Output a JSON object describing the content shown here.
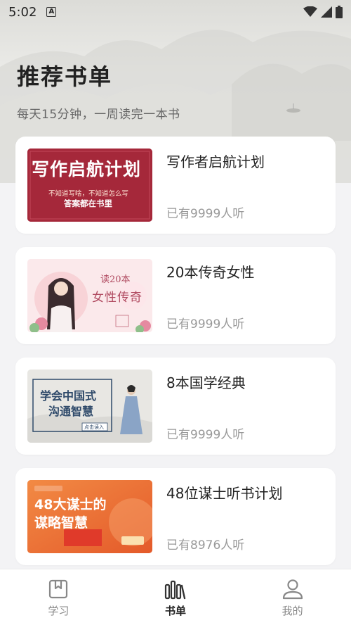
{
  "status_bar": {
    "time": "5:02",
    "notification_glyph": "A"
  },
  "header": {
    "title": "推荐书单",
    "subtitle": "每天15分钟，一周读完一本书"
  },
  "booklists": [
    {
      "title": "写作者启航计划",
      "listeners": "已有9999人听",
      "cover": {
        "headline": "写作启航计划",
        "line1": "不知道写啥，不知道怎么写",
        "line2": "答案都在书里",
        "bg": "#a5283a"
      }
    },
    {
      "title": "20本传奇女性",
      "listeners": "已有9999人听",
      "cover": {
        "headline_top": "读20本",
        "headline": "女性传奇",
        "bg": "#fbe8ea"
      }
    },
    {
      "title": "8本国学经典",
      "listeners": "已有9999人听",
      "cover": {
        "headline": "学会中国式",
        "headline2": "沟通智慧",
        "cta": "点击读入",
        "bg": "#e9e8e4"
      }
    },
    {
      "title": "48位谋士听书计划",
      "listeners": "已有8976人听",
      "cover": {
        "headline": "48大谋士的",
        "headline2": "谋略智慧",
        "bg": "#f07b3a"
      }
    }
  ],
  "tabbar": {
    "tabs": [
      {
        "label": "学习",
        "icon": "bookmark-book-icon"
      },
      {
        "label": "书单",
        "icon": "bookshelf-icon"
      },
      {
        "label": "我的",
        "icon": "person-icon"
      }
    ],
    "active": "书单"
  }
}
